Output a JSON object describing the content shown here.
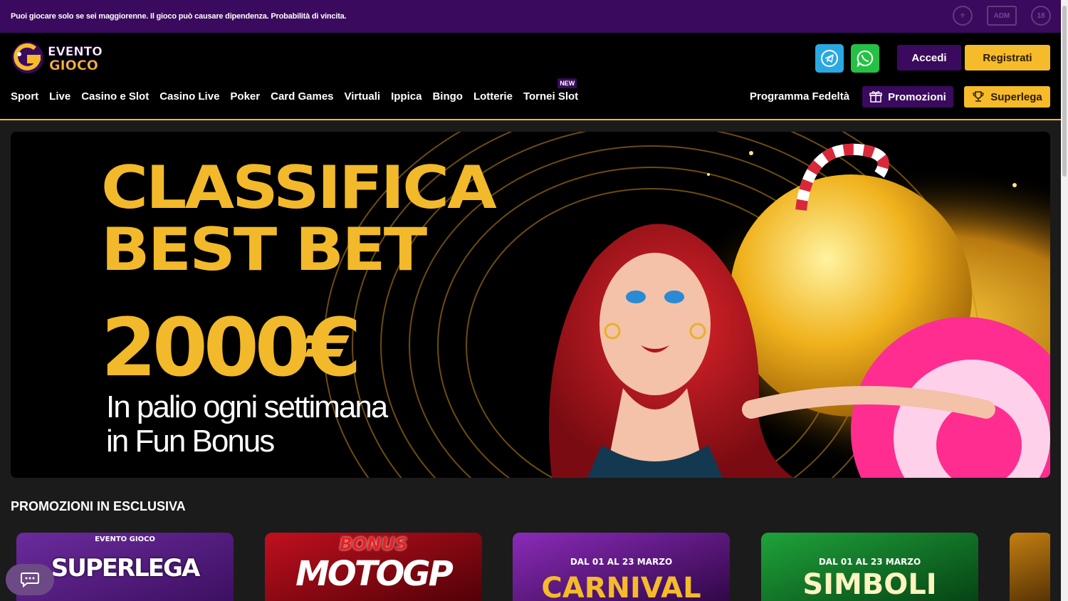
{
  "topbar": {
    "warning": "Puoi giocare solo se sei maggiorenne. Il gioco può causare dipendenza. Probabilità di vincita.",
    "badges": [
      "ADM",
      "18"
    ]
  },
  "logo": {
    "line1": "EVENTO",
    "line2": "GIOCO"
  },
  "header": {
    "login_label": "Accedi",
    "register_label": "Registrati",
    "telegram_icon": "telegram-icon",
    "whatsapp_icon": "whatsapp-icon"
  },
  "nav": {
    "items": [
      "Sport",
      "Live",
      "Casino e Slot",
      "Casino Live",
      "Poker",
      "Card Games",
      "Virtuali",
      "Ippica",
      "Bingo",
      "Lotterie",
      "Tornei Slot"
    ],
    "new_tag": "NEW",
    "loyalty": "Programma Fedeltà",
    "promotions": "Promozioni",
    "superlega": "Superlega"
  },
  "hero": {
    "line1": "CLASSIFICA",
    "line2": "BEST BET",
    "amount": "2000€",
    "sub1": "In palio ogni settimana",
    "sub2": "in Fun Bonus"
  },
  "promotions": {
    "title": "PROMOZIONI IN ESCLUSIVA",
    "cards": [
      {
        "title": "SUPERLEGA",
        "top": "EVENTO GIOCO"
      },
      {
        "title": "MOTOGP",
        "top": "BONUS"
      },
      {
        "title": "CARNIVAL",
        "top": "DAL 01 AL 23 MARZO"
      },
      {
        "title": "SIMBOLI",
        "top": "DAL 01 AL 23 MARZO"
      }
    ]
  },
  "colors": {
    "purple": "#3a0a5e",
    "gold": "#f5bb2a",
    "background": "#1b1b1b"
  }
}
